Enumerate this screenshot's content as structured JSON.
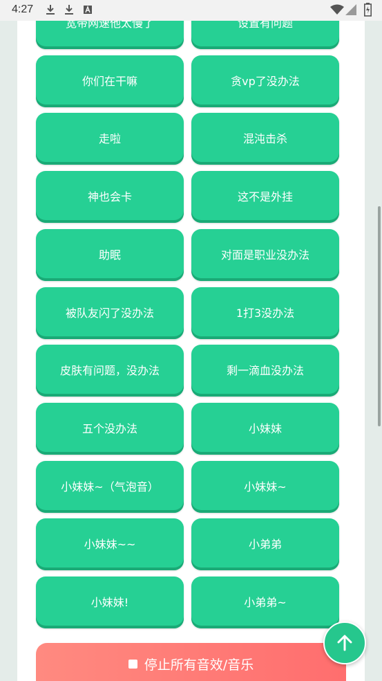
{
  "status_bar": {
    "time": "4:27",
    "icons": [
      "download-icon",
      "download-icon",
      "a-badge-icon",
      "wifi-icon",
      "signal-icon",
      "battery-icon"
    ]
  },
  "sound_buttons": [
    [
      "宽带网速他太慢了",
      "设置有问题"
    ],
    [
      "你们在干嘛",
      "贪vp了没办法"
    ],
    [
      "走啦",
      "混沌击杀"
    ],
    [
      "神也会卡",
      "这不是外挂"
    ],
    [
      "助眠",
      "对面是职业没办法"
    ],
    [
      "被队友闪了没办法",
      "1打3没办法"
    ],
    [
      "皮肤有问题，没办法",
      "剩一滴血没办法"
    ],
    [
      "五个没办法",
      "小妹妹"
    ],
    [
      "小妹妹~（气泡音）",
      "小妹妹~"
    ],
    [
      "小妹妹~~",
      "小弟弟"
    ],
    [
      "小妹妹!",
      "小弟弟~"
    ]
  ],
  "stop_button": {
    "label": "停止所有音效/音乐"
  },
  "colors": {
    "button": "#26d094",
    "button_shadow": "#1aaa76",
    "stop": "#ff7b78",
    "fab": "#26c78d"
  }
}
